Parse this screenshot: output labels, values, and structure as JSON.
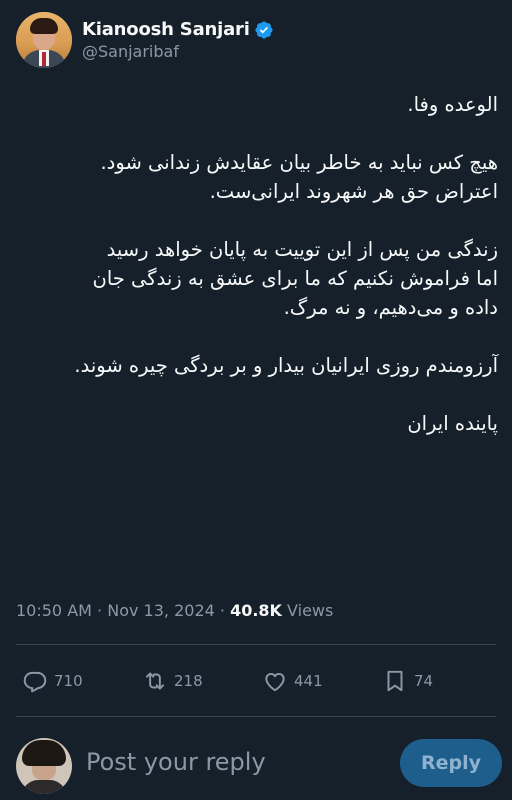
{
  "author": {
    "display_name": "Kianoosh Sanjari",
    "handle": "@Sanjaribaf",
    "verified": true
  },
  "tweet": {
    "paragraphs": [
      [
        "الوعده وفا."
      ],
      [
        "هیچ کس نباید به خاطر بیان عقایدش زندانی شود.",
        "اعتراض حق هر شهروند ایرانی‌ست."
      ],
      [
        "زندگی من پس از این توییت به پایان خواهد رسید",
        "اما فراموش نکنیم که ما برای عشق به زندگی جان",
        "داده و می‌دهیم، و نه مرگ."
      ],
      [
        "آرزومندم روزی ایرانیان بیدار و بر بردگی چیره شوند."
      ],
      [
        "پاینده ایران"
      ]
    ]
  },
  "meta": {
    "time": "10:50 AM",
    "separator": "·",
    "date": "Nov 13, 2024",
    "views_count": "40.8K",
    "views_label": "Views"
  },
  "actions": {
    "replies": "710",
    "retweets": "218",
    "likes": "441",
    "bookmarks": "74"
  },
  "reply_bar": {
    "placeholder": "Post your reply",
    "button_label": "Reply"
  },
  "colors": {
    "background": "#15202b",
    "text": "#f7f9f9",
    "secondary": "#8b98a5",
    "verified": "#1d9bf0",
    "reply_button": "#1d5e8c"
  }
}
